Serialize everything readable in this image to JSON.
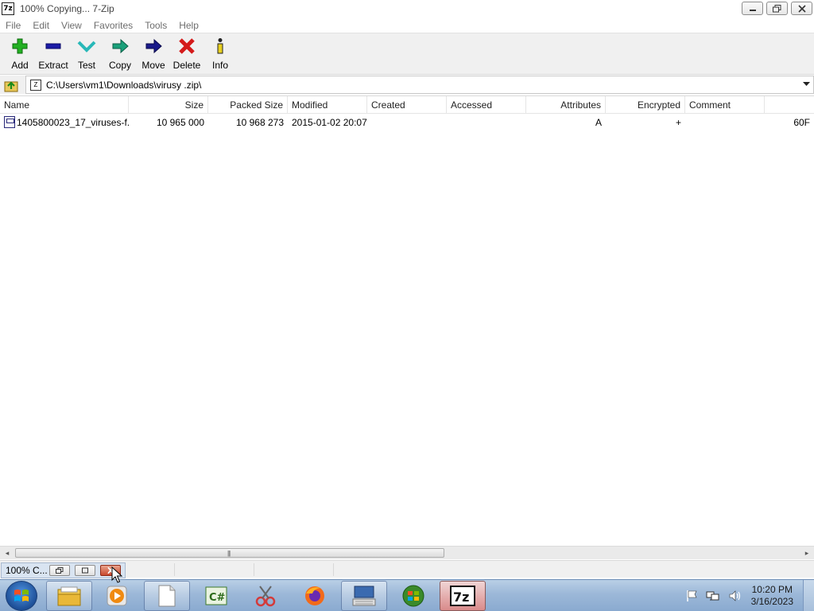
{
  "window": {
    "title": "100% Copying... 7-Zip",
    "app_icon_text": "7z"
  },
  "menu": [
    "File",
    "Edit",
    "View",
    "Favorites",
    "Tools",
    "Help"
  ],
  "toolbar": [
    {
      "label": "Add",
      "icon": "plus-icon",
      "color": "#22b022"
    },
    {
      "label": "Extract",
      "icon": "minus-icon",
      "color": "#1a1aa6"
    },
    {
      "label": "Test",
      "icon": "check-icon",
      "color": "#28b8b8"
    },
    {
      "label": "Copy",
      "icon": "copy-arrow-icon",
      "color": "#1aa07a"
    },
    {
      "label": "Move",
      "icon": "move-arrow-icon",
      "color": "#1a1a8a"
    },
    {
      "label": "Delete",
      "icon": "x-icon",
      "color": "#d41a1a"
    },
    {
      "label": "Info",
      "icon": "info-icon",
      "color": "#8a6a00"
    }
  ],
  "address": {
    "path": "C:\\Users\\vm1\\Downloads\\virusy .zip\\"
  },
  "columns": [
    "Name",
    "Size",
    "Packed Size",
    "Modified",
    "Created",
    "Accessed",
    "Attributes",
    "Encrypted",
    "Comment",
    ""
  ],
  "files": [
    {
      "name": "1405800023_17_viruses-f...",
      "size": "10 965 000",
      "packed_size": "10 968 273",
      "modified": "2015-01-02 20:07",
      "created": "",
      "accessed": "",
      "attributes": "A",
      "encrypted": "+",
      "comment": "",
      "extra": "60F"
    }
  ],
  "progress_window": {
    "title": "100% C..."
  },
  "taskbar": {
    "apps": [
      "file-explorer-icon",
      "media-player-icon",
      "blank-document-icon",
      "csharp-icon",
      "snipping-tool-icon",
      "firefox-icon",
      "keyboard-monitor-icon",
      "windows-update-icon",
      "7zip-icon"
    ],
    "clock_time": "10:20 PM",
    "clock_date": "3/16/2023"
  }
}
